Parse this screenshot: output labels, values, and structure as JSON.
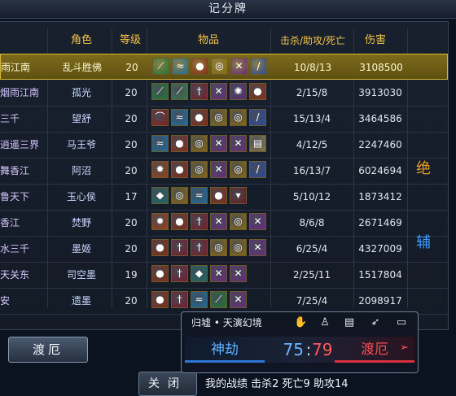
{
  "window": {
    "title": "记分牌"
  },
  "headers": {
    "role": "角色",
    "level": "等级",
    "items": "物品",
    "kda": "击杀/助攻/死亡",
    "damage": "伤害"
  },
  "players": [
    {
      "name": "雨江南",
      "role": "乱斗胜佛",
      "level": "20",
      "kda": "10/8/13",
      "damage": "3108500",
      "selected": true,
      "items": [
        "blade-icon",
        "wave-icon",
        "fire-orb-icon",
        "spiral-icon",
        "claw-icon",
        "sword-icon"
      ]
    },
    {
      "name": "烟雨江南",
      "role": "孤光",
      "level": "20",
      "kda": "2/15/8",
      "damage": "3913030",
      "items": [
        "blade-icon",
        "feather-icon",
        "dagger-icon",
        "claw-icon",
        "dragon-icon",
        "fire-orb-icon"
      ]
    },
    {
      "name": "三千",
      "role": "望舒",
      "level": "20",
      "kda": "15/13/4",
      "damage": "3464586",
      "items": [
        "bow-icon",
        "wave-icon",
        "fire-orb-icon",
        "spiral-icon",
        "spiral-icon",
        "sword-icon"
      ]
    },
    {
      "name": "逍遥三界",
      "role": "马王爷",
      "level": "20",
      "kda": "4/12/5",
      "damage": "2247460",
      "items": [
        "wave-icon",
        "fire-orb-icon",
        "spiral-icon",
        "claw-icon",
        "claw-icon",
        "scroll-icon"
      ]
    },
    {
      "name": "舞香江",
      "role": "阿沼",
      "level": "20",
      "kda": "16/13/7",
      "damage": "6024694",
      "items": [
        "flame-icon",
        "fire-orb-icon",
        "spiral-icon",
        "claw-icon",
        "spiral-icon",
        "sword-icon"
      ]
    },
    {
      "name": "鲁天下",
      "role": "玉心侯",
      "level": "17",
      "kda": "5/10/12",
      "damage": "1873412",
      "items": [
        "gem-icon",
        "spiral-icon",
        "wave-icon",
        "fire-orb-icon",
        "potion-icon"
      ]
    },
    {
      "name": "香江",
      "role": "焚野",
      "level": "20",
      "kda": "8/6/8",
      "damage": "2671469",
      "items": [
        "flame-icon",
        "fire-orb-icon",
        "dagger-icon",
        "claw-icon",
        "spiral-icon",
        "claw-icon"
      ]
    },
    {
      "name": "水三千",
      "role": "墨姬",
      "level": "20",
      "kda": "6/25/4",
      "damage": "4327009",
      "items": [
        "fire-orb-icon",
        "dagger-icon",
        "dagger-icon",
        "spiral-icon",
        "spiral-icon",
        "claw-icon"
      ]
    },
    {
      "name": "天关东",
      "role": "司空墨",
      "level": "19",
      "kda": "2/25/11",
      "damage": "1517804",
      "items": [
        "fire-orb-icon",
        "dagger-icon",
        "gem-icon",
        "claw-icon",
        "claw-icon"
      ]
    },
    {
      "name": "安",
      "role": "遗墨",
      "level": "20",
      "kda": "7/25/4",
      "damage": "2098917",
      "items": [
        "fire-orb-icon",
        "dagger-icon",
        "wave-icon",
        "blade-icon",
        "claw-icon"
      ]
    }
  ],
  "tags": [
    {
      "text": "绝",
      "color": "#f0a020"
    },
    {
      "text": "辅",
      "color": "#3a9cff"
    }
  ],
  "team_button": "渡厄",
  "close_button": "关闭",
  "match": {
    "location": "归墟 • 天演幻境",
    "team_a": "神劫",
    "team_b": "渡厄",
    "score_a": "75",
    "score_sep": ":",
    "score_b": "79",
    "icons": [
      "hand-icon",
      "person-icon",
      "document-icon",
      "running-icon",
      "window-icon"
    ]
  },
  "my_stats": "我的战绩   击杀2  死亡9  助攻14",
  "item_colors": {
    "blade-icon": "#1f7a3a",
    "wave-icon": "#1c6ea0",
    "fire-orb-icon": "#8a2a10",
    "spiral-icon": "#8a6a10",
    "claw-icon": "#6a2a80",
    "sword-icon": "#2a4aa0",
    "feather-icon": "#3a7a4a",
    "dagger-icon": "#7a1a2a",
    "dragon-icon": "#5a2a7a",
    "bow-icon": "#8a1a1a",
    "scroll-icon": "#8a7a4a",
    "flame-icon": "#a04010",
    "gem-icon": "#1a6a6a",
    "potion-icon": "#6a1a1a"
  },
  "item_glyphs": {
    "blade-icon": "⟋",
    "wave-icon": "≈",
    "fire-orb-icon": "●",
    "spiral-icon": "◎",
    "claw-icon": "✕",
    "sword-icon": "/",
    "feather-icon": "⟋",
    "dagger-icon": "†",
    "dragon-icon": "✺",
    "bow-icon": "⌒",
    "scroll-icon": "▤",
    "flame-icon": "✹",
    "gem-icon": "◆",
    "potion-icon": "▾"
  },
  "panel_icon_glyphs": {
    "hand-icon": "✋",
    "person-icon": "♙",
    "document-icon": "▤",
    "running-icon": "➶",
    "window-icon": "▭"
  }
}
